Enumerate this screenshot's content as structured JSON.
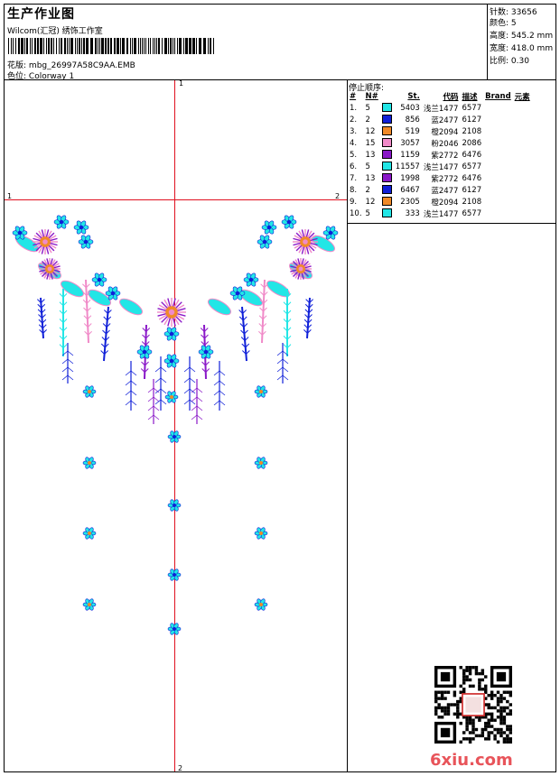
{
  "header": {
    "title": "生产作业图",
    "studio": "Wilcom(汇冠) 绣饰工作室",
    "file_label": "花版:",
    "file_name": "mbg_26997A58C9AA.EMB",
    "color_label": "色位:",
    "color_name": "Colorway 1"
  },
  "stats": [
    {
      "label": "针数:",
      "value": "33656"
    },
    {
      "label": "颜色:",
      "value": "5"
    },
    {
      "label": "高度:",
      "value": "545.2 mm"
    },
    {
      "label": "宽度:",
      "value": "418.0 mm"
    },
    {
      "label": "比例:",
      "value": "0.30"
    }
  ],
  "stop_sequence": {
    "title": "停止顺序:",
    "headers": [
      "#",
      "N#",
      "St.",
      "代码",
      "描述",
      "Brand",
      "元素"
    ],
    "rows": [
      {
        "idx": "1.",
        "n": "5",
        "color": "#22e6e6",
        "st": "5403",
        "code": "浅兰1477",
        "desc": "6577"
      },
      {
        "idx": "2.",
        "n": "2",
        "color": "#1020d8",
        "st": "856",
        "code": "蓝2477",
        "desc": "6127"
      },
      {
        "idx": "3.",
        "n": "12",
        "color": "#f08a28",
        "st": "519",
        "code": "橙2094",
        "desc": "2108"
      },
      {
        "idx": "4.",
        "n": "15",
        "color": "#f08ac8",
        "st": "3057",
        "code": "粉2046",
        "desc": "2086"
      },
      {
        "idx": "5.",
        "n": "13",
        "color": "#8a18c8",
        "st": "1159",
        "code": "紫2772",
        "desc": "6476"
      },
      {
        "idx": "6.",
        "n": "5",
        "color": "#22e6e6",
        "st": "11557",
        "code": "浅兰1477",
        "desc": "6577"
      },
      {
        "idx": "7.",
        "n": "13",
        "color": "#8a18c8",
        "st": "1998",
        "code": "紫2772",
        "desc": "6476"
      },
      {
        "idx": "8.",
        "n": "2",
        "color": "#1020d8",
        "st": "6467",
        "code": "蓝2477",
        "desc": "6127"
      },
      {
        "idx": "9.",
        "n": "12",
        "color": "#f08a28",
        "st": "2305",
        "code": "橙2094",
        "desc": "2108"
      },
      {
        "idx": "10.",
        "n": "5",
        "color": "#22e6e6",
        "st": "333",
        "code": "浅兰1477",
        "desc": "6577"
      }
    ]
  },
  "markers": {
    "top": "1",
    "bottom": "2",
    "left": "1",
    "right": "2"
  },
  "watermark": "6xiu.com",
  "colors": {
    "cyan": "#22e6e6",
    "blue": "#1020d8",
    "orange": "#f08a28",
    "pink": "#f08ac8",
    "purple": "#8a18c8",
    "red_line": "#e01020"
  }
}
